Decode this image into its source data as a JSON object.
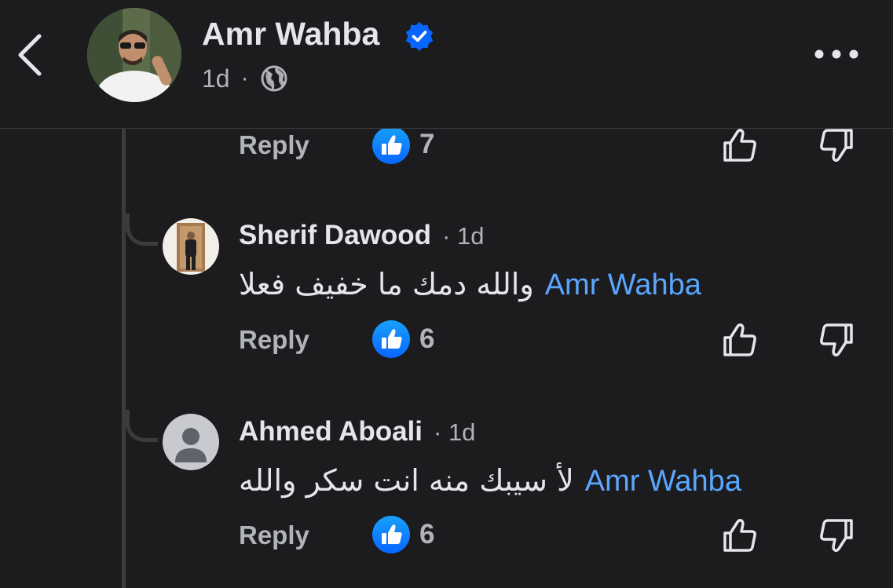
{
  "post": {
    "author": "Amr Wahba",
    "time": "1d",
    "privacy_icon": "globe-icon",
    "verified_icon": "verified-badge-icon"
  },
  "first_actions": {
    "reply_label": "Reply",
    "like_count": "7"
  },
  "comments": [
    {
      "name": "Sherif Dawood",
      "time": "1d",
      "mention": "Amr Wahba",
      "text": "والله دمك ما خفيف فعلا",
      "reply_label": "Reply",
      "like_count": "6"
    },
    {
      "name": "Ahmed Aboali",
      "time": "1d",
      "mention": "Amr Wahba",
      "text": "لأ سيبك منه انت سكر والله",
      "reply_label": "Reply",
      "like_count": "6"
    }
  ],
  "colors": {
    "background": "#1c1c1e",
    "accent": "#0866ff",
    "mention": "#5aa7ff",
    "secondary_text": "#b0b3b8"
  }
}
